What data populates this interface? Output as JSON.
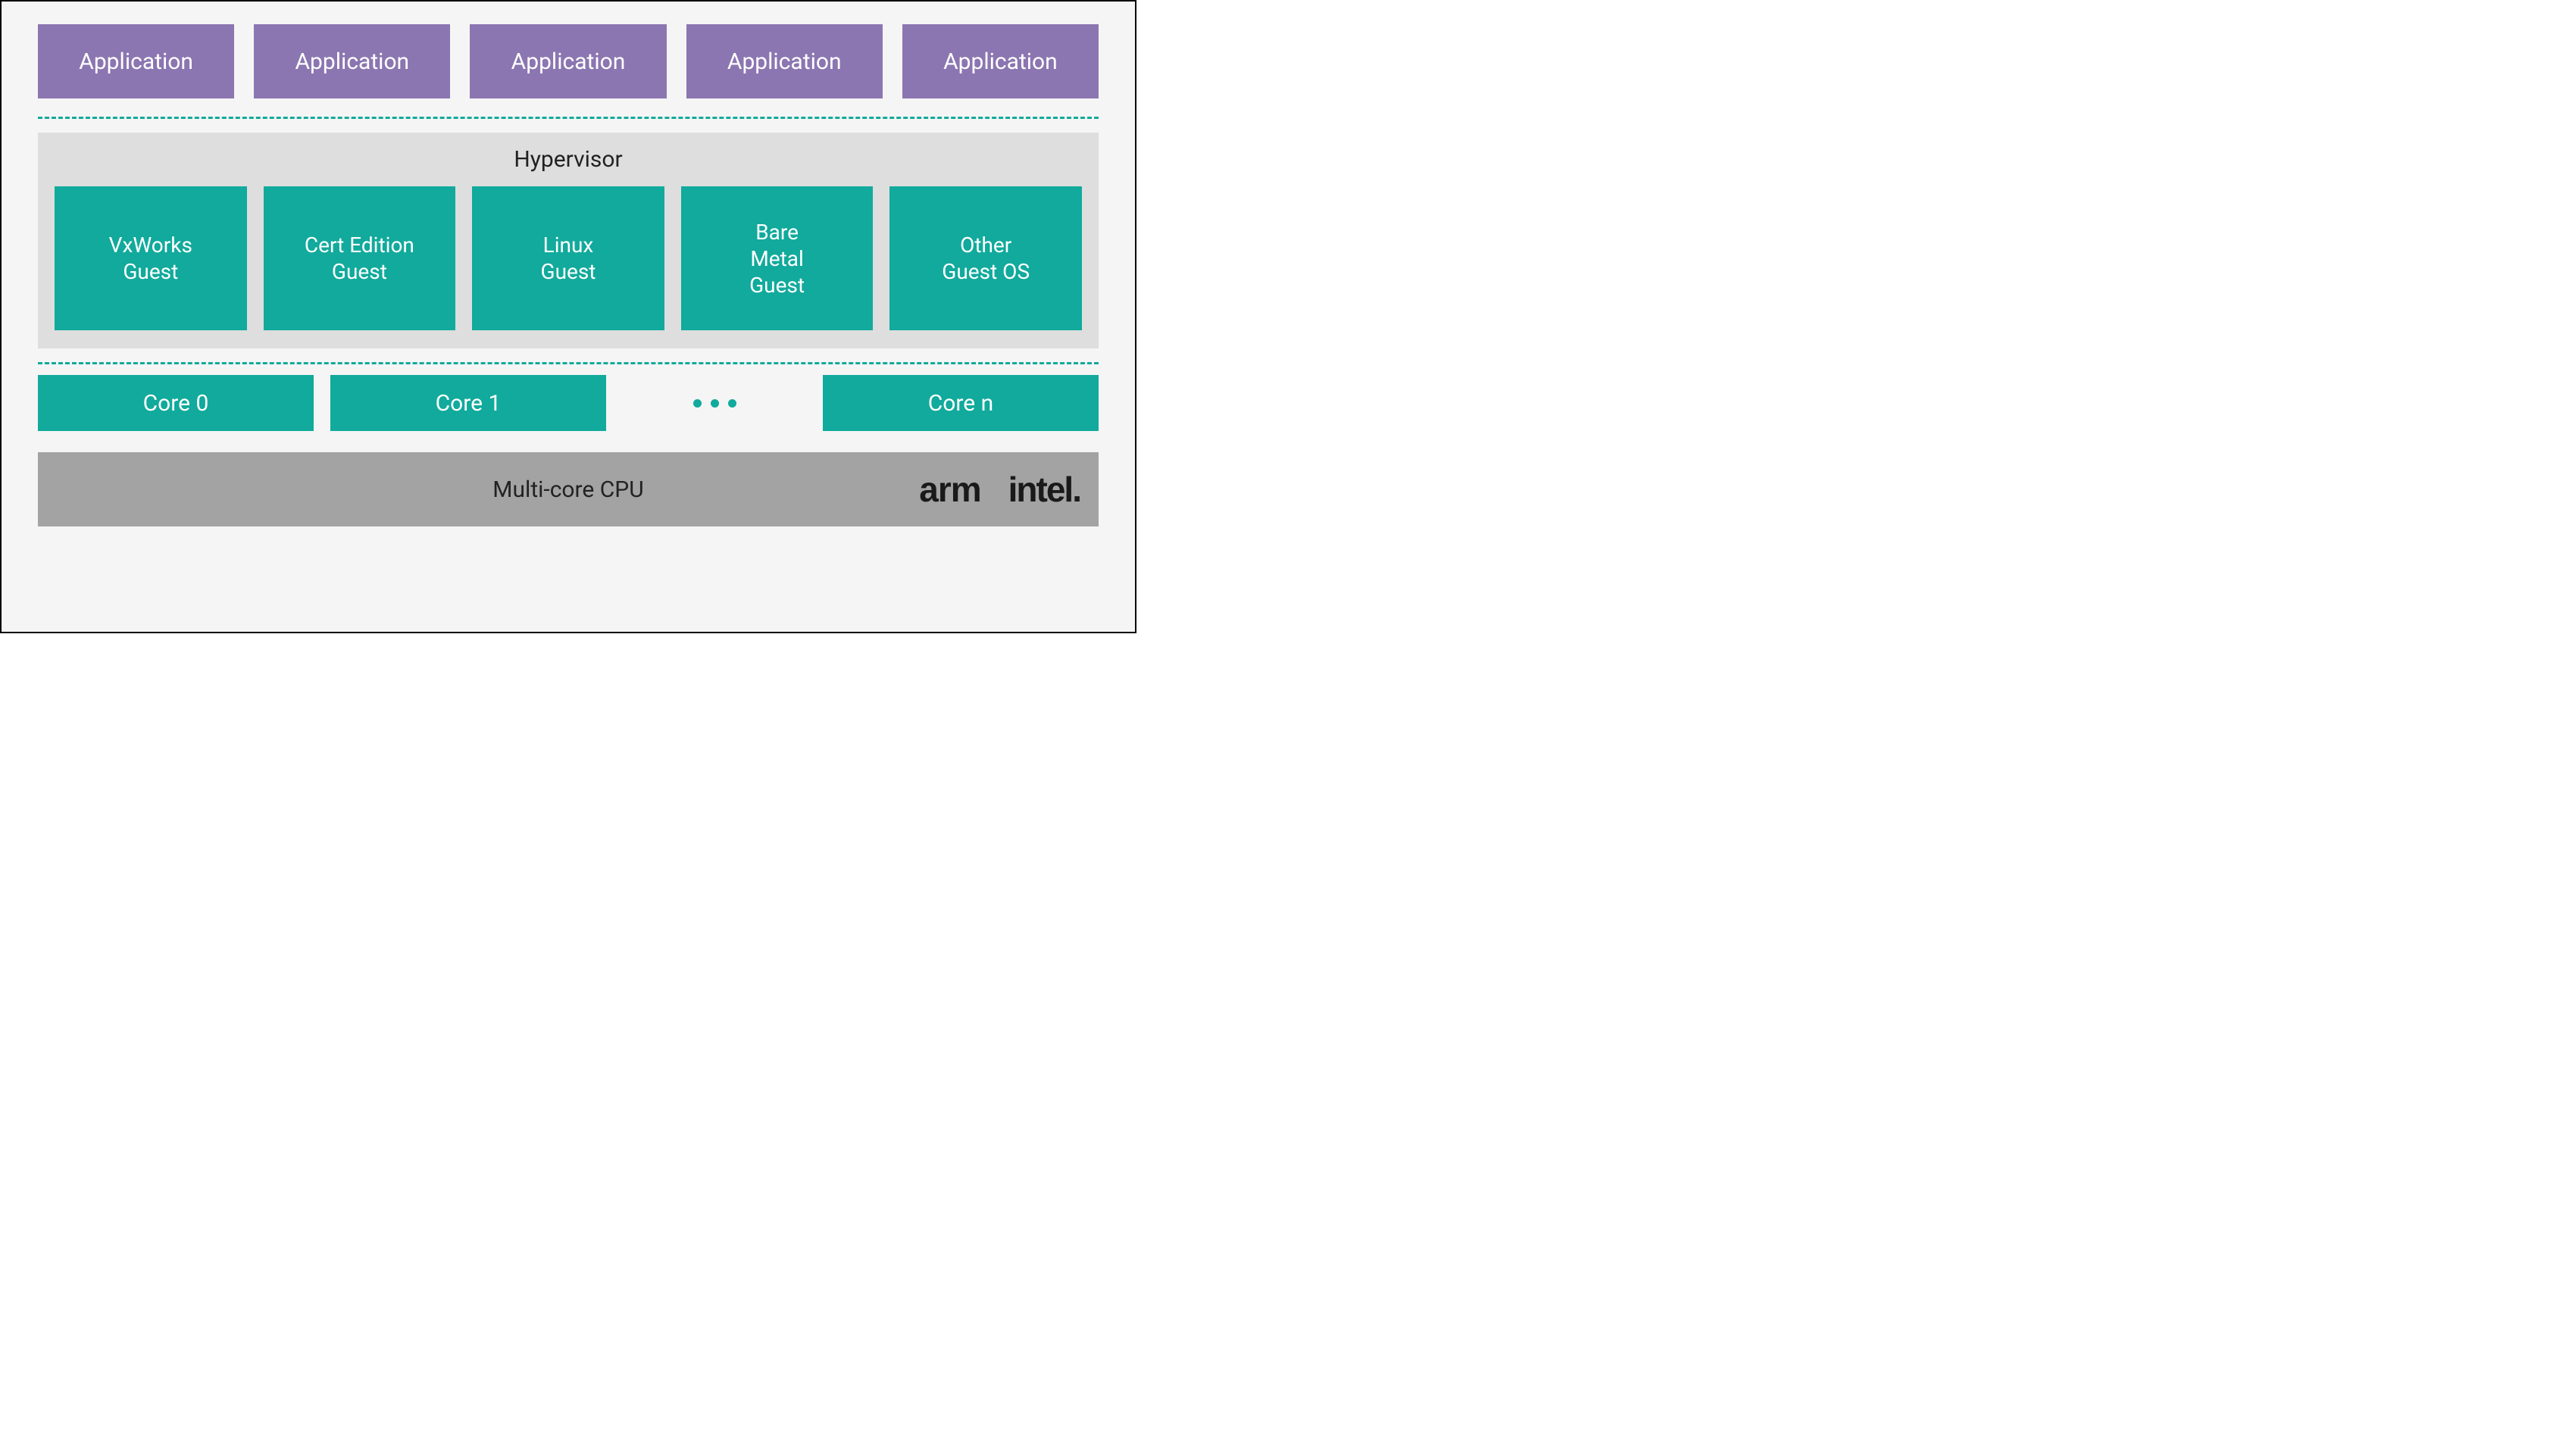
{
  "applications": [
    "Application",
    "Application",
    "Application",
    "Application",
    "Application"
  ],
  "hypervisor_label": "Hypervisor",
  "guests": [
    "VxWorks\nGuest",
    "Cert Edition\nGuest",
    "Linux\nGuest",
    "Bare\nMetal\nGuest",
    "Other\nGuest OS"
  ],
  "cores": {
    "first": "Core 0",
    "second": "Core 1",
    "last": "Core n"
  },
  "cpu_label": "Multi-core CPU",
  "vendors": {
    "arm": "arm",
    "intel": "intel."
  },
  "colors": {
    "teal": "#11aa9c",
    "purple": "#8b76b1",
    "grey_light": "#dedede",
    "grey_mid": "#a3a3a3",
    "page_bg": "#f5f5f5"
  }
}
